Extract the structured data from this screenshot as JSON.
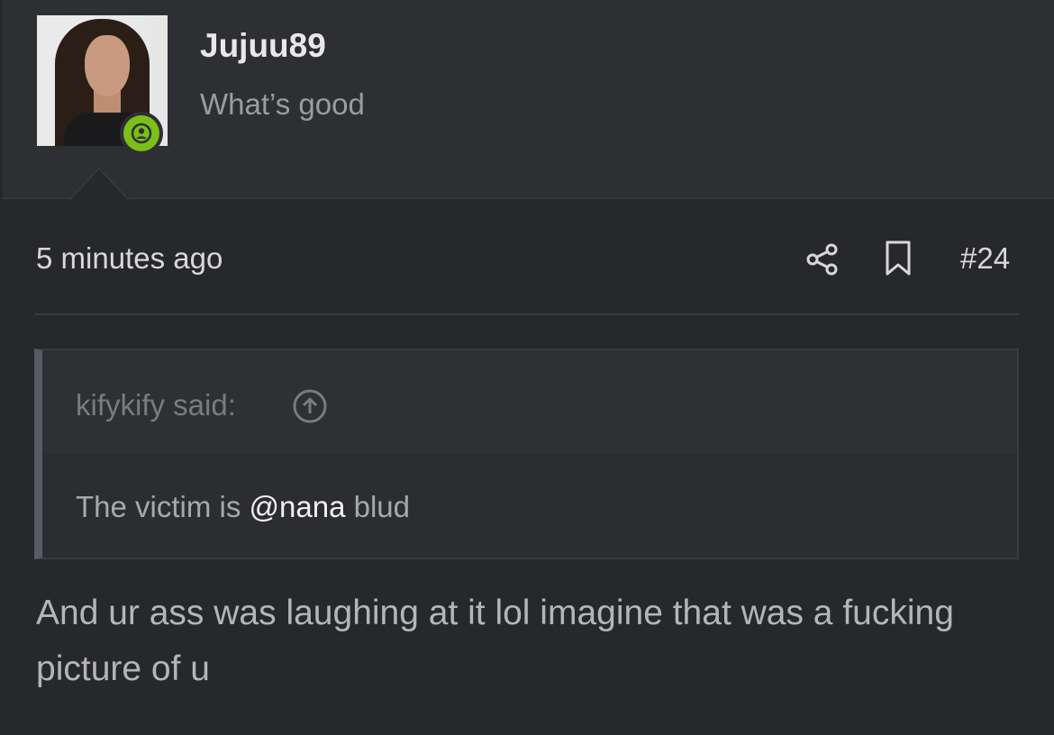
{
  "user": {
    "name": "Jujuu89",
    "title": "What’s good",
    "avatar_icon": "profile-photo",
    "online_icon": "person-icon",
    "online_color": "#7cbf19"
  },
  "post": {
    "timestamp": "5 minutes ago",
    "number": "#24",
    "share_icon": "share-icon",
    "bookmark_icon": "bookmark-icon"
  },
  "quote": {
    "author": "kifykify said:",
    "jump_icon": "arrow-up-circle-icon",
    "text_before": "The victim is ",
    "mention": "@nana",
    "text_after": " blud"
  },
  "message": {
    "text": "And ur ass was laughing at it lol imagine that was a fucking picture of u"
  }
}
